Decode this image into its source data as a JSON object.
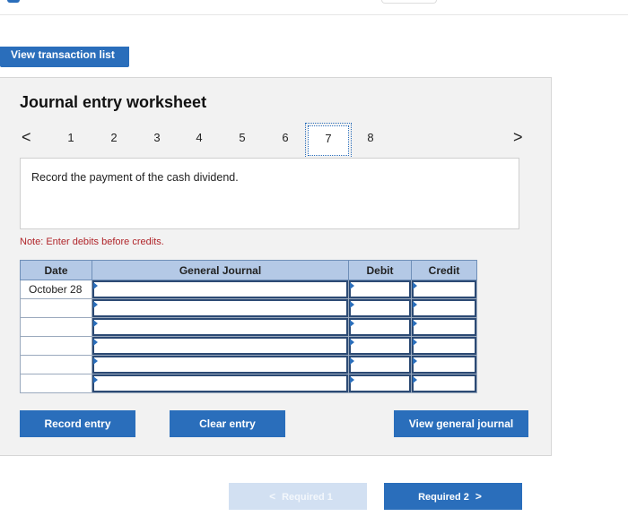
{
  "header": {
    "view_transaction_list_label": "View transaction list"
  },
  "worksheet": {
    "title": "Journal entry worksheet",
    "steps": [
      "1",
      "2",
      "3",
      "4",
      "5",
      "6",
      "7",
      "8"
    ],
    "active_step": "7",
    "prev_glyph": "<",
    "next_glyph": ">",
    "instruction": "Record the payment of the cash dividend.",
    "note": "Note: Enter debits before credits."
  },
  "journal": {
    "headers": {
      "date": "Date",
      "general_journal": "General Journal",
      "debit": "Debit",
      "credit": "Credit"
    },
    "rows": [
      {
        "date": "October 28"
      },
      {
        "date": ""
      },
      {
        "date": ""
      },
      {
        "date": ""
      },
      {
        "date": ""
      },
      {
        "date": ""
      }
    ]
  },
  "actions": {
    "record_entry": "Record entry",
    "clear_entry": "Clear entry",
    "view_general_journal": "View general journal"
  },
  "pager": {
    "prev_label": "Required 1",
    "next_label": "Required 2",
    "prev_glyph": "<",
    "next_glyph": ">"
  },
  "colors": {
    "accent": "#2a6ebb",
    "header_fill": "#b4c9e6",
    "note_red": "#b0252a",
    "panel_bg": "#f2f2f2"
  }
}
